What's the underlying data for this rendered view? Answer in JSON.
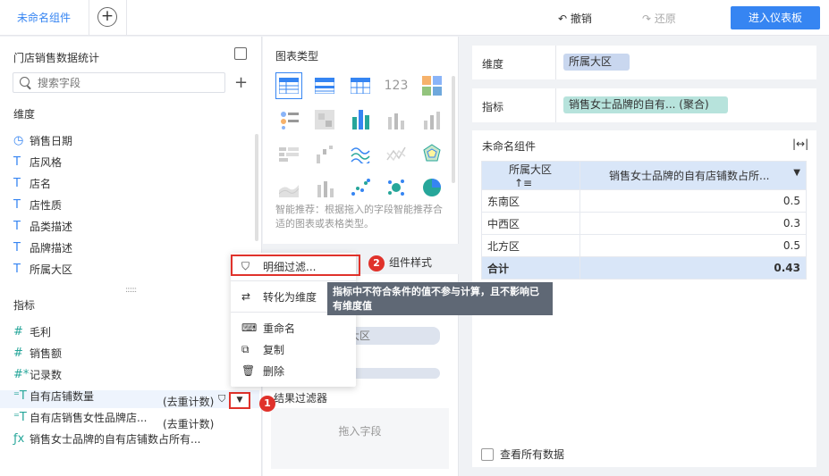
{
  "topbar": {
    "tab_name": "未命名组件",
    "add_tab": "+",
    "undo": "撤销",
    "redo": "还原",
    "enter_dashboard": "进入仪表板"
  },
  "left": {
    "dataset_title": "门店销售数据统计",
    "search_placeholder": "搜索字段",
    "add": "+",
    "dimension_section": "维度",
    "dimensions": [
      {
        "icon": "clock-icon",
        "glyph": "◷",
        "label": "销售日期"
      },
      {
        "icon": "text-type-icon",
        "glyph": "T",
        "label": "店风格"
      },
      {
        "icon": "text-type-icon",
        "glyph": "T",
        "label": "店名"
      },
      {
        "icon": "text-type-icon",
        "glyph": "T",
        "label": "店性质"
      },
      {
        "icon": "text-type-icon",
        "glyph": "T",
        "label": "品类描述"
      },
      {
        "icon": "text-type-icon",
        "glyph": "T",
        "label": "品牌描述"
      },
      {
        "icon": "text-type-icon",
        "glyph": "T",
        "label": "所属大区"
      }
    ],
    "measure_section": "指标",
    "measures": [
      {
        "icon": "number-icon",
        "glyph": "#",
        "label": "毛利"
      },
      {
        "icon": "number-icon",
        "glyph": "#",
        "label": "销售额"
      },
      {
        "icon": "number-star-icon",
        "glyph": "#*",
        "label": "记录数"
      },
      {
        "icon": "text-measure-icon",
        "glyph": "⁼T",
        "label": "自有店铺数量"
      },
      {
        "icon": "text-measure-icon",
        "glyph": "⁼T",
        "label": "自有店销售女性品牌店..."
      },
      {
        "icon": "formula-icon",
        "glyph": "ƒx",
        "label": "销售女士品牌的自有店铺数占所有..."
      }
    ],
    "distinct_tag_1": "(去重计数)",
    "distinct_tag_2": "(去重计数)"
  },
  "middle": {
    "chart_type_title": "图表类型",
    "hint": "智能推荐：根据拖入的字段智能推荐合适的图表或表格类型。",
    "style_tab": "组件样式",
    "dim_partial": "大区",
    "result_filter": "结果过滤器",
    "drag_field": "拖入字段"
  },
  "context_menu": {
    "items": [
      {
        "icon": "filter-icon",
        "glyph": "⛉",
        "label": "明细过滤..."
      },
      {
        "icon": "convert-icon",
        "glyph": "⇄",
        "label": "转化为维度"
      },
      {
        "icon": "rename-icon",
        "glyph": "⌨",
        "label": "重命名"
      },
      {
        "icon": "copy-icon",
        "glyph": "⧉",
        "label": "复制"
      },
      {
        "icon": "delete-icon",
        "glyph": "🗑",
        "label": "删除"
      }
    ],
    "badge_1": "1",
    "badge_2": "2",
    "tooltip": "指标中不符合条件的值不参与计算，且不影响已有维度值"
  },
  "right": {
    "dimension_label": "维度",
    "dimension_value": "所属大区",
    "measure_label": "指标",
    "measure_value": "销售女士品牌的自有... (聚合)",
    "component_title": "未命名组件",
    "table": {
      "col1": "所属大区",
      "col1_sort_icon": "sort-icon",
      "col2": "销售女士品牌的自有店铺数占所...",
      "rows": [
        {
          "region": "东南区",
          "value": "0.5"
        },
        {
          "region": "中西区",
          "value": "0.3"
        },
        {
          "region": "北方区",
          "value": "0.5"
        }
      ],
      "total_label": "合计",
      "total_value": "0.43"
    },
    "view_all": "查看所有数据"
  },
  "colors": {
    "accent": "#3685f2",
    "highlight_red": "#e0322b",
    "table_header": "#d9e6f8",
    "dimension_pill": "#c9d7ef",
    "measure_pill": "#b7e3dc"
  }
}
